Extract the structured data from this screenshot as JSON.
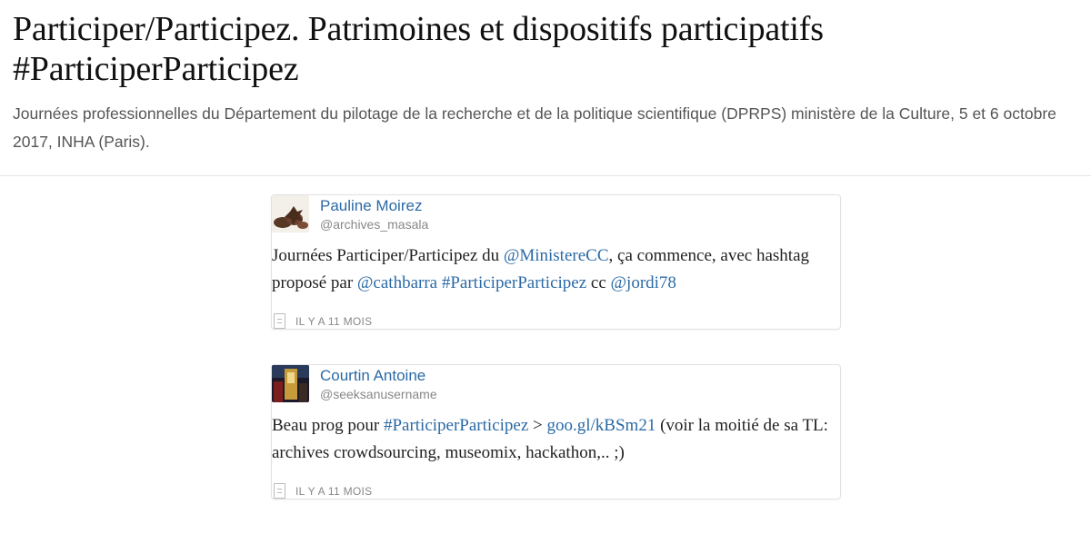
{
  "header": {
    "title": "Participer/Participez. Patrimoines et dispositifs participatifs #ParticiperParticipez",
    "subtitle": "Journées professionnelles du Département du pilotage de la recherche et de la politique scientifique (DPRPS) ministère de la Culture, 5 et 6 octobre 2017, INHA (Paris)."
  },
  "tweets": [
    {
      "name": "Pauline Moirez",
      "handle": "@archives_masala",
      "text": {
        "t1": "Journées Participer/Participez du ",
        "l1": "@MinistereCC",
        "t2": ", ça commence, avec hashtag proposé par ",
        "l2": "@cathbarra",
        "t3": " ",
        "l3": "#ParticiperParticipez",
        "t4": " cc ",
        "l4": "@jordi78"
      },
      "time": "IL Y A 11 MOIS"
    },
    {
      "name": "Courtin Antoine",
      "handle": "@seeksanusername",
      "text": {
        "t1": "Beau prog pour ",
        "l1": "#ParticiperParticipez",
        "t2": " > ",
        "l2": "goo.gl/kBSm21",
        "t3": " (voir la moitié de sa TL: archives crowdsourcing, museomix, hackathon,.. ;)"
      },
      "time": "IL Y A 11 MOIS"
    }
  ]
}
